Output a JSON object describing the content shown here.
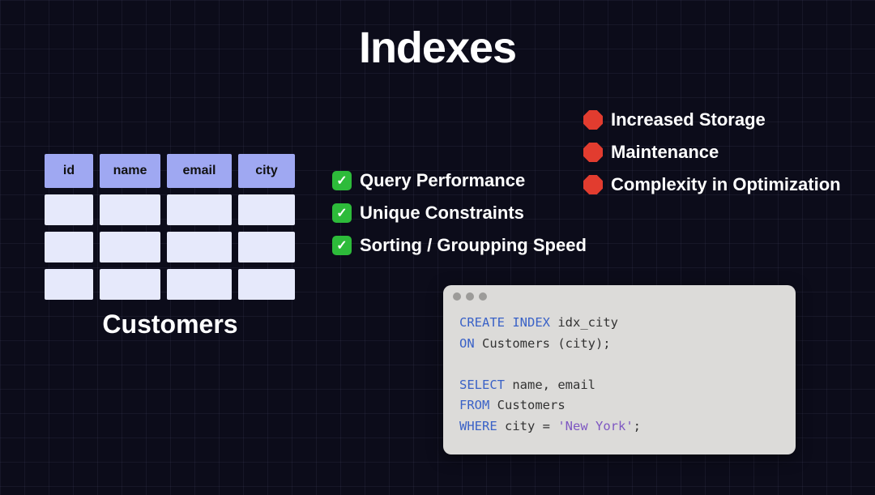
{
  "title": "Indexes",
  "table": {
    "columns": [
      "id",
      "name",
      "email",
      "city"
    ],
    "rows": 3,
    "caption": "Customers"
  },
  "pros": [
    "Query Performance",
    "Unique Constraints",
    "Sorting / Groupping Speed"
  ],
  "cons": [
    "Increased Storage",
    "Maintenance",
    "Complexity in Optimization"
  ],
  "code": {
    "tokens": [
      {
        "t": "CREATE",
        "c": "kw"
      },
      {
        "t": " ",
        "c": "tk"
      },
      {
        "t": "INDEX",
        "c": "kw"
      },
      {
        "t": " idx_city",
        "c": "tk"
      },
      {
        "t": "\n",
        "c": "tk"
      },
      {
        "t": "ON",
        "c": "kw"
      },
      {
        "t": " Customers (city);",
        "c": "tk"
      },
      {
        "t": "\n",
        "c": "tk"
      },
      {
        "t": "\n",
        "c": "tk"
      },
      {
        "t": "SELECT",
        "c": "kw"
      },
      {
        "t": " name, email",
        "c": "tk"
      },
      {
        "t": "\n",
        "c": "tk"
      },
      {
        "t": "FROM",
        "c": "kw"
      },
      {
        "t": " Customers",
        "c": "tk"
      },
      {
        "t": "\n",
        "c": "tk"
      },
      {
        "t": "WHERE",
        "c": "kw"
      },
      {
        "t": " city = ",
        "c": "tk"
      },
      {
        "t": "'New York'",
        "c": "str"
      },
      {
        "t": ";",
        "c": "tk"
      }
    ]
  }
}
